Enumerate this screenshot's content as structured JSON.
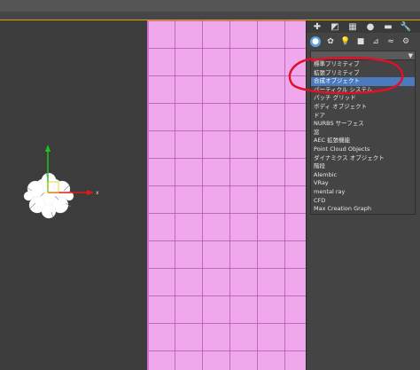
{
  "panel": {
    "dropdown": {
      "items": [
        "標準プリミティブ",
        "拡張プリミティブ",
        "合成オブジェクト",
        "パーティクル システム",
        "パッチ グリッド",
        "ボディ オブジェクト",
        "ドア",
        "NURBS サーフェス",
        "窓",
        "AEC 拡張機能",
        "Point Cloud Objects",
        "ダイナミクス オブジェクト",
        "階段",
        "Alembic",
        "VRay",
        "mental ray",
        "CFD",
        "Max Creation Graph"
      ],
      "selected_index": 2
    }
  },
  "viewport": {
    "gizmo_axis_label": "x"
  },
  "colors": {
    "grid_fill": "#f0a8ec",
    "selection": "#4b7bbd",
    "annotation": "#e0102a"
  }
}
